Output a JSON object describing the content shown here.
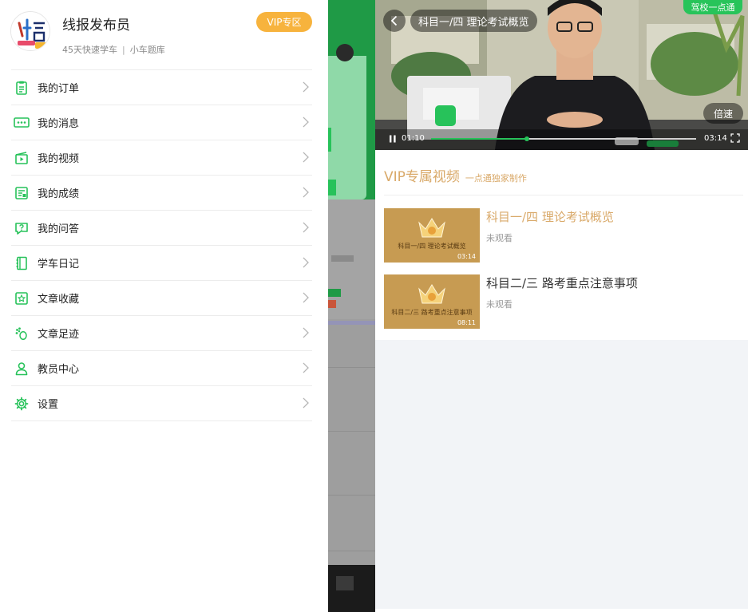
{
  "profile": {
    "name": "线报发布员",
    "stat_learn": "45天快速学车",
    "separator": "|",
    "stat_bank": "小车题库",
    "vip_label": "VIP专区"
  },
  "menu": [
    {
      "label": "我的订单",
      "icon": "order-icon"
    },
    {
      "label": "我的消息",
      "icon": "message-icon"
    },
    {
      "label": "我的视频",
      "icon": "video-icon"
    },
    {
      "label": "我的成绩",
      "icon": "score-icon"
    },
    {
      "label": "我的问答",
      "icon": "qa-icon"
    },
    {
      "label": "学车日记",
      "icon": "diary-icon"
    },
    {
      "label": "文章收藏",
      "icon": "favorite-icon"
    },
    {
      "label": "文章足迹",
      "icon": "footprint-icon"
    },
    {
      "label": "教员中心",
      "icon": "coach-icon"
    },
    {
      "label": "设置",
      "icon": "gear-icon"
    }
  ],
  "player": {
    "title": "科目一/四 理论考试概览",
    "brand": "驾校一点通",
    "speed_label": "倍速",
    "current_time": "01:10",
    "total_time": "03:14",
    "progress": 0.36
  },
  "section": {
    "title": "VIP专属视频",
    "subtitle": "一点通独家制作"
  },
  "videos": [
    {
      "title": "科目一/四 理论考试概览",
      "thumb_text": "科目一/四 理论考试概览",
      "duration": "03:14",
      "status": "未观看",
      "color": "#d9a969"
    },
    {
      "title": "科目二/三 路考重点注意事项",
      "thumb_text": "科目二/三 路考重点注意事项",
      "duration": "08:11",
      "status": "未观看",
      "color": "#333333"
    }
  ],
  "colors": {
    "accent_green": "#27c25a",
    "vip_gold": "#d9a969",
    "vip_button": "#f7b33d"
  }
}
